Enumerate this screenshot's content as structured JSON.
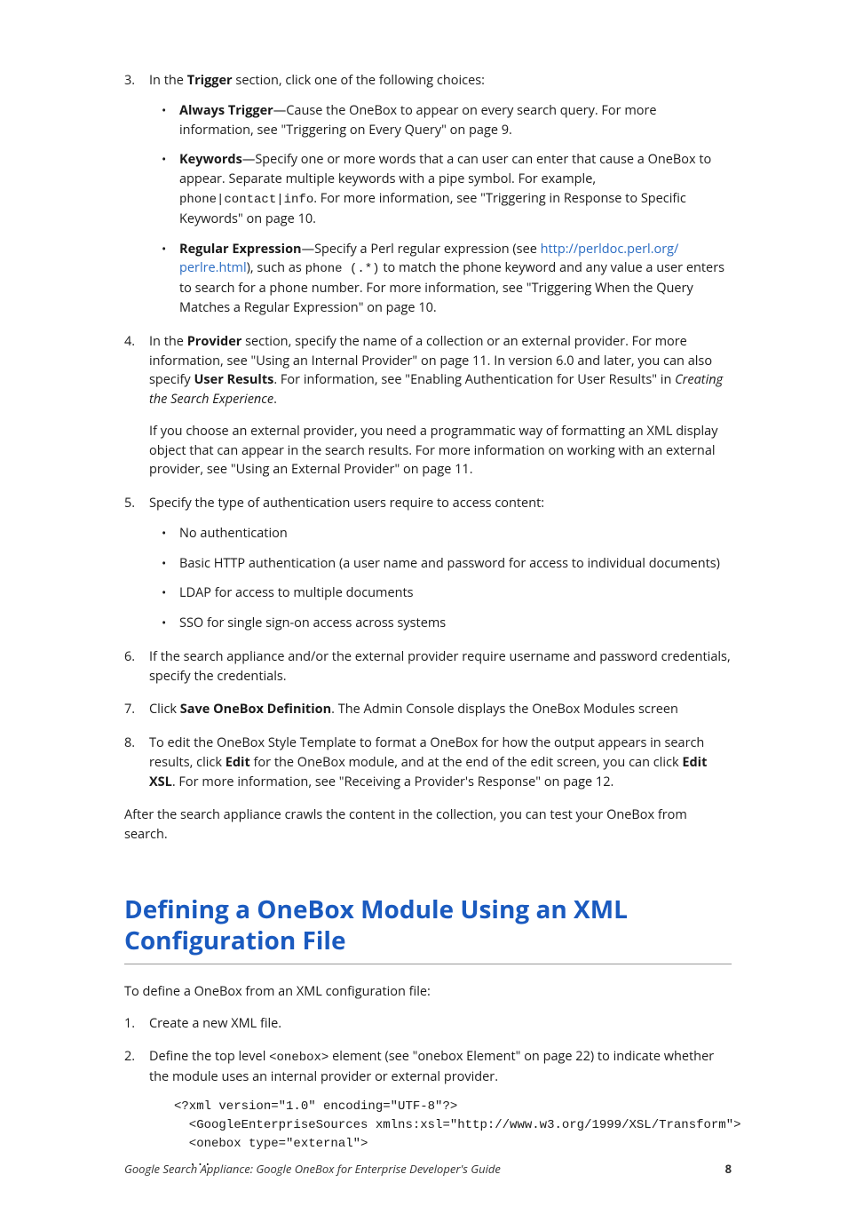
{
  "item3": {
    "marker": "3.",
    "prefix": "In the ",
    "bold": "Trigger",
    "suffix": " section, click one of the following choices:",
    "bullets": [
      {
        "bold": "Always Trigger",
        "rest": "—Cause the OneBox to appear on every search query. For more information, see \"Triggering on Every Query\" on page 9."
      },
      {
        "bold": "Keywords",
        "rest_before_code": "—Specify one or more words that a can user can enter that cause a OneBox to appear. Separate multiple keywords with a pipe symbol. For example, ",
        "code": "phone|contact|info",
        "rest_after_code": ". For more information, see \"Triggering in Response to Specific Keywords\" on page 10."
      },
      {
        "bold": "Regular Expression",
        "pre_link": "—Specify a Perl regular expression (see ",
        "link1": "http://perldoc.perl.org/",
        "link2": "perlre.html",
        "after_link": "), such as ",
        "code": "phone (.*)",
        "after_code": " to match the phone keyword and any value a user enters to search for a phone number. For more information, see \"Triggering When the Query Matches a Regular Expression\" on page 10."
      }
    ]
  },
  "item4": {
    "marker": "4.",
    "prefix": "In the ",
    "bold1": "Provider",
    "mid1": " section, specify the name of a collection or an external provider. For more information, see \"Using an Internal Provider\" on page 11. In version 6.0 and later, you can also specify ",
    "bold2": "User Results",
    "mid2": ". For information, see \"Enabling Authentication for User Results\" in ",
    "italic": "Creating the Search Experience",
    "end": ".",
    "para2": "If you choose an external provider, you need a programmatic way of formatting an XML display object that can appear in the search results. For more information on working with an external provider, see \"Using an External Provider\" on page 11."
  },
  "item5": {
    "marker": "5.",
    "text": "Specify the type of authentication users require to access content:",
    "bullets": [
      "No authentication",
      "Basic HTTP authentication (a user name and password for access to individual documents)",
      "LDAP for access to multiple documents",
      "SSO for single sign-on access across systems"
    ]
  },
  "item6": {
    "marker": "6.",
    "text": "If the search appliance and/or the external provider require username and password credentials, specify the credentials."
  },
  "item7": {
    "marker": "7.",
    "pre": "Click ",
    "bold": "Save OneBox Definition",
    "post": ". The Admin Console displays the OneBox Modules screen"
  },
  "item8": {
    "marker": "8.",
    "p1": "To edit the OneBox Style Template to format a OneBox for how the output appears in search results, click ",
    "bold1": "Edit",
    "p2": " for the OneBox module, and at the end of the edit screen, you can click ",
    "bold2": "Edit XSL",
    "p3": ". For more information, see \"Receiving a Provider's Response\" on page 12."
  },
  "after_list": "After the search appliance crawls the content in the collection, you can test your OneBox from search.",
  "heading": "Defining a OneBox Module Using an XML Configuration File",
  "intro2": "To define a OneBox from an XML configuration file:",
  "s2_item1": {
    "marker": "1.",
    "text": "Create a new XML file."
  },
  "s2_item2": {
    "marker": "2.",
    "pre": "Define the top level ",
    "code": "<onebox>",
    "post": " element (see \"onebox Element\" on page 22) to indicate whether the module uses an internal provider or external provider."
  },
  "codeblock": "<?xml version=\"1.0\" encoding=\"UTF-8\"?>\n  <GoogleEnterpriseSources xmlns:xsl=\"http://www.w3.org/1999/XSL/Transform\">\n  <onebox type=\"external\">\n  ...",
  "footer": {
    "title": "Google Search Appliance: Google OneBox for Enterprise Developer's Guide",
    "page": "8"
  }
}
